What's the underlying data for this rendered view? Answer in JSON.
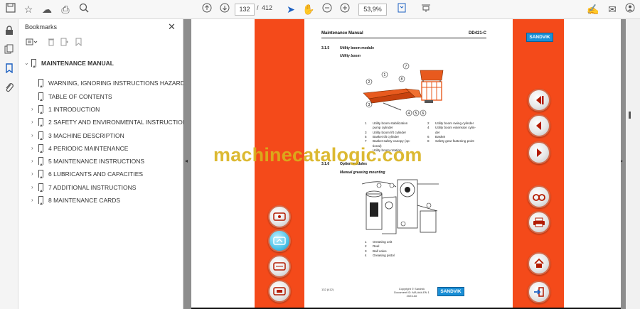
{
  "toolbar": {
    "icons": [
      "save-icon",
      "bookmark-star-icon",
      "upload-icon",
      "print-icon",
      "zoom-search-icon",
      "page-up-icon",
      "page-down-icon",
      "select-arrow-icon",
      "hand-icon",
      "zoom-out-icon",
      "zoom-in-icon",
      "fit-page-icon",
      "scroll-mode-icon",
      "sign-icon",
      "mail-icon",
      "account-icon"
    ],
    "page_current": "132",
    "page_separator": "/",
    "page_total": "412",
    "zoom": "53,9%"
  },
  "panel": {
    "title": "Bookmarks",
    "close": "✕"
  },
  "bookmarks": [
    {
      "label": "MAINTENANCE MANUAL",
      "level": 0,
      "expandable": true,
      "expanded": true
    },
    {
      "label": "WARNING, IGNORING INSTRUCTIONS HAZARD",
      "level": 1,
      "expandable": false
    },
    {
      "label": "TABLE OF CONTENTS",
      "level": 1,
      "expandable": false
    },
    {
      "label": "1 INTRODUCTION",
      "level": 1,
      "expandable": true
    },
    {
      "label": "2 SAFETY AND ENVIRONMENTAL INSTRUCTIONS",
      "level": 1,
      "expandable": true
    },
    {
      "label": "3 MACHINE DESCRIPTION",
      "level": 1,
      "expandable": true
    },
    {
      "label": "4 PERIODIC MAINTENANCE",
      "level": 1,
      "expandable": true
    },
    {
      "label": "5 MAINTENANCE INSTRUCTIONS",
      "level": 1,
      "expandable": true
    },
    {
      "label": "6 LUBRICANTS AND CAPACITIES",
      "level": 1,
      "expandable": true
    },
    {
      "label": "7 ADDITIONAL INSTRUCTIONS",
      "level": 1,
      "expandable": true
    },
    {
      "label": "8 MAINTENANCE CARDS",
      "level": 1,
      "expandable": true
    }
  ],
  "document": {
    "header_left": "Maintenance Manual",
    "header_right": "DD421-C",
    "brand": "SANDVIK",
    "section1_num": "3.1.5",
    "section1_title": "Utility boom module",
    "section1_sub": "Utility boom",
    "legend1": [
      {
        "n": "1",
        "t": "Utility boom stabilization"
      },
      {
        "n": "",
        "t": "pump cylinder"
      },
      {
        "n": "3",
        "t": "Utility boom lift cylinder"
      },
      {
        "n": "5",
        "t": "Basket tilt cylinder"
      },
      {
        "n": "7",
        "t": "Basket safety canopy (op-"
      },
      {
        "n": "",
        "t": "tional)"
      },
      {
        "n": "",
        "t": "Utility boom rotation"
      }
    ],
    "legend2": [
      {
        "n": "2",
        "t": "Utility boom swing cylinder"
      },
      {
        "n": "4",
        "t": "Utility boom extension cylin-"
      },
      {
        "n": "",
        "t": "der"
      },
      {
        "n": "6",
        "t": "Basket"
      },
      {
        "n": "8",
        "t": "Safety gear fastening point"
      }
    ],
    "section2_num": "3.1.6",
    "section2_title": "Option modules",
    "section2_sub": "Manual greasing mounting",
    "legend3": [
      {
        "n": "1",
        "t": "Greasing unit"
      },
      {
        "n": "2",
        "t": "Reel"
      },
      {
        "n": "3",
        "t": "Ball valve"
      },
      {
        "n": "4",
        "t": "Greasing pistol"
      }
    ],
    "footer_page": "132 (412)",
    "footer_copy1": "Copyright © Sandvik",
    "footer_copy2": "Document ID: MA-###-EN 1 2023-##"
  },
  "nav_left": [
    {
      "icon": "view-page-icon",
      "glyph": "⊟"
    },
    {
      "icon": "view-zoom-icon",
      "glyph": "⊡"
    },
    {
      "icon": "view-list-icon",
      "glyph": "▤"
    },
    {
      "icon": "view-print-icon",
      "glyph": "⎙"
    }
  ],
  "nav_right": [
    {
      "icon": "first-page-icon",
      "glyph": "◀|"
    },
    {
      "icon": "previous-page-icon",
      "glyph": "◀"
    },
    {
      "icon": "next-page-icon",
      "glyph": "▶"
    },
    {
      "icon": "binoculars-icon",
      "glyph": "⚭"
    },
    {
      "icon": "printer-icon",
      "glyph": "⎙"
    },
    {
      "icon": "home-icon",
      "glyph": "⌂"
    },
    {
      "icon": "exit-icon",
      "glyph": "⇥"
    }
  ],
  "watermark": "machinecatalogic.com",
  "colors": {
    "accent": "#f44a1a",
    "brand": "#1a8fd6",
    "watermark": "#d9b21c"
  }
}
